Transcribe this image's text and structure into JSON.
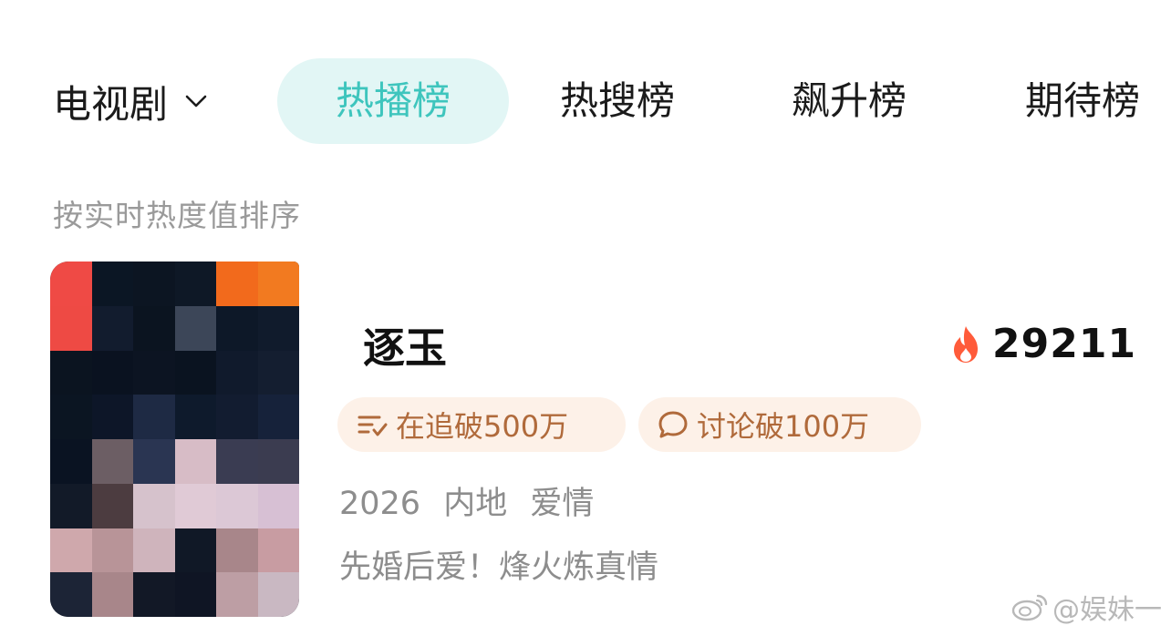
{
  "tabs": {
    "category": "电视剧",
    "items": [
      "热播榜",
      "热搜榜",
      "飙升榜",
      "期待榜"
    ],
    "active_index": 0,
    "accent_color": "#3ec5bd"
  },
  "subtitle": "按实时热度值排序",
  "show": {
    "title": "逐玉",
    "heat": "29211",
    "badges": {
      "follow": "在追破500万",
      "discuss": "讨论破100万"
    },
    "meta": {
      "year": "2026",
      "region": "内地",
      "genre": "爱情"
    },
    "description": "先婚后爱！烽火炼真情"
  },
  "watermark": "@娱妹一",
  "icons": {
    "category": "chevron-down-icon",
    "heat": "flame-icon",
    "follow": "check-list-icon",
    "discuss": "comment-icon",
    "watermark": "weibo-icon"
  }
}
